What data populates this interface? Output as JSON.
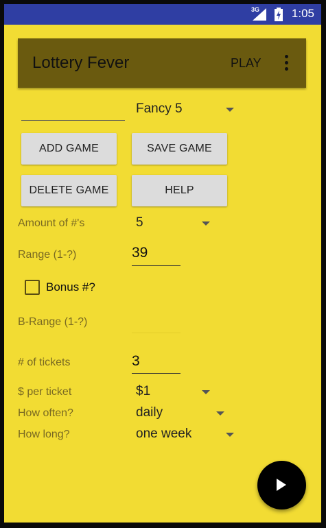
{
  "status_bar": {
    "network_label": "3G",
    "time": "1:05",
    "icons": [
      "signal-icon",
      "battery-icon"
    ],
    "bar_color": "#2f3ea3"
  },
  "app_bar": {
    "title": "Lottery Fever",
    "play_label": "PLAY",
    "overflow_icon": "overflow-menu-icon",
    "bar_color": "#6a5a0f"
  },
  "game_row": {
    "name_value": "",
    "game_select": "Fancy 5"
  },
  "buttons": {
    "add": "ADD GAME",
    "save": "SAVE GAME",
    "delete": "DELETE GAME",
    "help": "HELP"
  },
  "form": {
    "amount_label": "Amount of #'s",
    "amount_value": "5",
    "range_label": "Range (1-?)",
    "range_value": "39",
    "bonus_label": "Bonus #?",
    "bonus_checked": false,
    "brange_label": "B-Range (1-?)",
    "brange_value": "",
    "tickets_label": "# of tickets",
    "tickets_value": "3",
    "price_label": "$ per ticket",
    "price_value": "$1",
    "often_label": "How often?",
    "often_value": "daily",
    "long_label": "How long?",
    "long_value": "one week"
  },
  "fab": {
    "icon": "play-icon"
  },
  "theme": {
    "background": "#f2dc33",
    "fab_color": "#000000"
  }
}
